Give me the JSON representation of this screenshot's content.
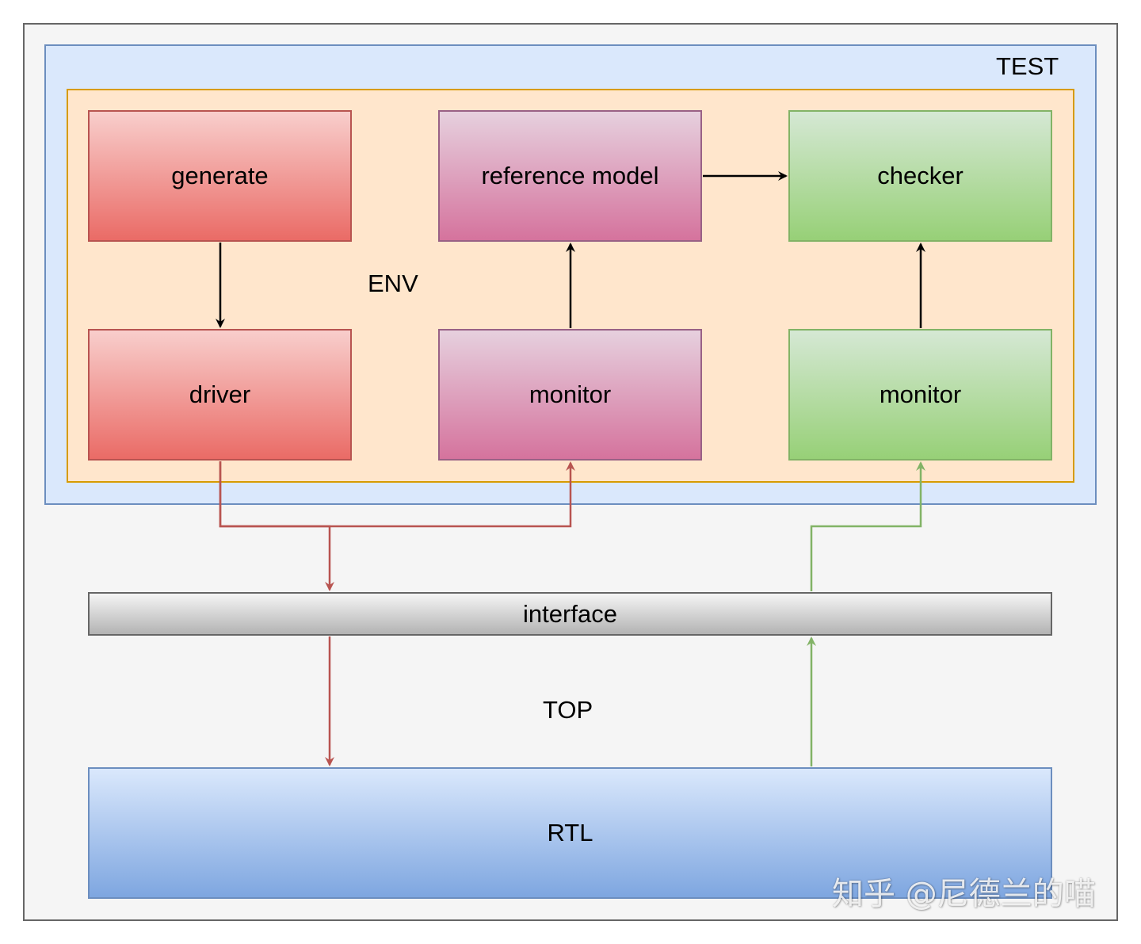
{
  "containers": {
    "top_label": "TOP",
    "test_label": "TEST",
    "env_label": "ENV"
  },
  "nodes": {
    "generate": "generate",
    "driver": "driver",
    "reference_model": "reference model",
    "monitor_in": "monitor",
    "checker": "checker",
    "monitor_out": "monitor",
    "interface": "interface",
    "rtl": "RTL"
  },
  "watermark": "知乎 @尼德兰的喵",
  "colors": {
    "top_fill": "#f5f5f5",
    "test_fill": "#dae8fc",
    "env_fill": "#ffe6cc",
    "red_edge": "#b85450",
    "green_edge": "#82b366",
    "black_edge": "#000000"
  },
  "edges": [
    {
      "from": "generate",
      "to": "driver",
      "color": "black"
    },
    {
      "from": "monitor_in",
      "to": "reference_model",
      "color": "black"
    },
    {
      "from": "reference_model",
      "to": "checker",
      "color": "black"
    },
    {
      "from": "monitor_out",
      "to": "checker",
      "color": "black"
    },
    {
      "from": "driver",
      "to": "interface",
      "color": "red"
    },
    {
      "from": "driver",
      "to": "monitor_in",
      "color": "red"
    },
    {
      "from": "interface",
      "to": "rtl",
      "color": "red"
    },
    {
      "from": "rtl",
      "to": "interface",
      "color": "green"
    },
    {
      "from": "interface",
      "to": "monitor_out",
      "color": "green"
    }
  ]
}
